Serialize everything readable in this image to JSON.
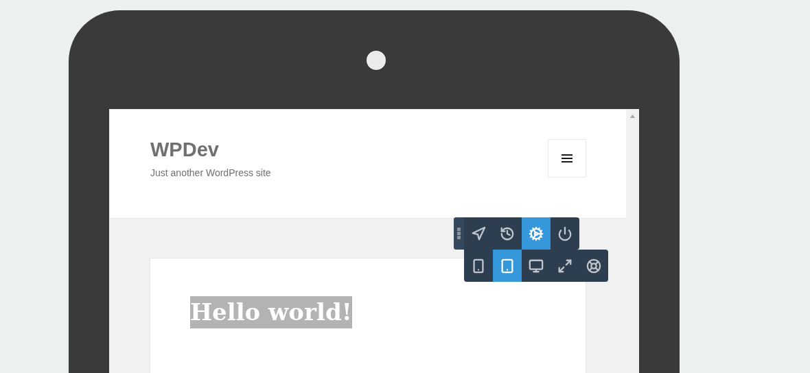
{
  "site": {
    "title": "WPDev",
    "tagline": "Just another WordPress site"
  },
  "toolbar": {
    "rows": [
      [
        {
          "kind": "navigate",
          "selected": false
        },
        {
          "kind": "history",
          "selected": false
        },
        {
          "kind": "settings",
          "selected": true
        },
        {
          "kind": "power",
          "selected": false
        }
      ],
      [
        {
          "kind": "phone",
          "selected": false
        },
        {
          "kind": "tablet",
          "selected": true
        },
        {
          "kind": "desktop",
          "selected": false
        },
        {
          "kind": "expand",
          "selected": false
        },
        {
          "kind": "help",
          "selected": false
        }
      ]
    ]
  },
  "post": {
    "title": "Hello world!",
    "highlighted": true
  }
}
